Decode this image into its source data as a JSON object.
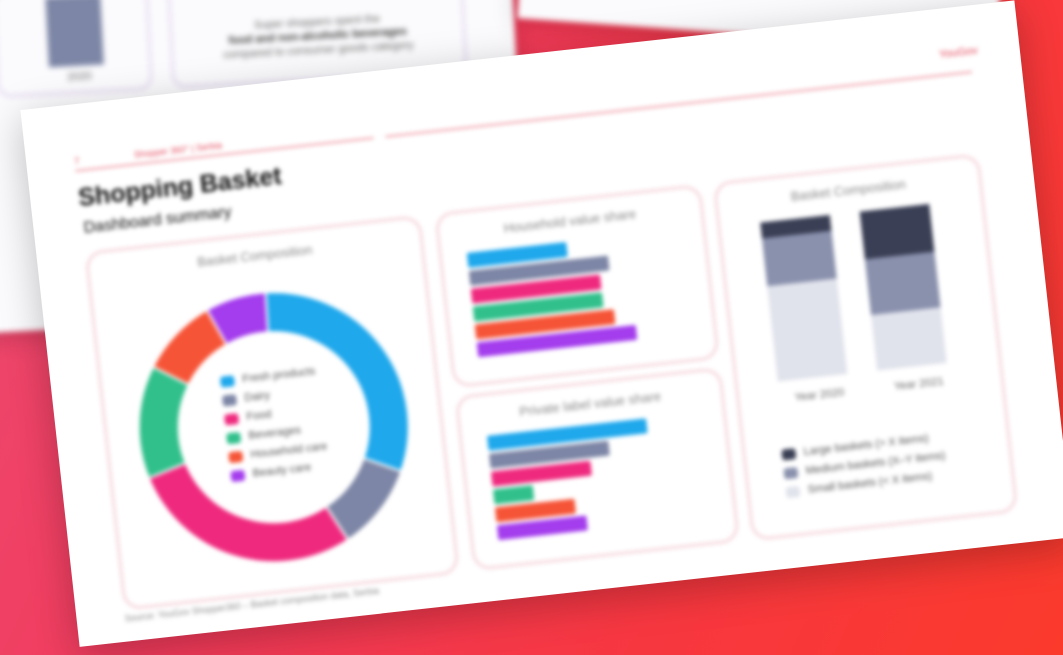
{
  "header": {
    "page_number": "7",
    "breadcrumb": "Shopper 360° | Serbia",
    "logo": "YouGov"
  },
  "title": "Shopping Basket",
  "subtitle": "Dashboard summary",
  "cards": {
    "donut_title": "Basket Composition",
    "brand_title": "Household value share",
    "pl_title": "Private label value share",
    "stack_title": "Basket Composition"
  },
  "colors": {
    "blue": "#1fa8ec",
    "slate": "#7d86a6",
    "pink": "#ef2a7e",
    "green": "#31c08c",
    "orange": "#f65437",
    "purple": "#a43ded",
    "dark": "#3a3f55",
    "mid": "#8a91ad",
    "light": "#c9cddc"
  },
  "donut_legend": [
    {
      "label": "Fresh products",
      "color": "#1fa8ec"
    },
    {
      "label": "Dairy",
      "color": "#7d86a6"
    },
    {
      "label": "Food",
      "color": "#ef2a7e"
    },
    {
      "label": "Beverages",
      "color": "#31c08c"
    },
    {
      "label": "Household care",
      "color": "#f65437"
    },
    {
      "label": "Beauty care",
      "color": "#a43ded"
    }
  ],
  "stack_legend": [
    {
      "label": "Large baskets (> X items)",
      "color": "#3a3f55"
    },
    {
      "label": "Medium baskets (X–Y items)",
      "color": "#8a91ad"
    },
    {
      "label": "Small baskets (< X items)",
      "color": "#e1e3ec"
    }
  ],
  "stack_axis": [
    "Year 2020",
    "Year 2021"
  ],
  "footer": "Source: YouGov Shopper360 – Basket composition data, Serbia",
  "background": {
    "left_text_1": "Super shoppers spent the",
    "left_text_2": "food and non-alcoholic beverages",
    "left_text_3": "compared to consumer goods category",
    "left_axis": "2020"
  },
  "chart_data": [
    {
      "type": "pie",
      "title": "Basket Composition",
      "categories": [
        "Fresh products",
        "Dairy",
        "Food",
        "Beverages",
        "Household care",
        "Beauty care"
      ],
      "values": [
        30,
        10,
        27,
        13,
        9,
        7
      ]
    },
    {
      "type": "bar",
      "title": "Household value share",
      "categories": [
        "Fresh products",
        "Dairy",
        "Food",
        "Beverages",
        "Household care",
        "Beauty care"
      ],
      "values": [
        50,
        70,
        65,
        65,
        70,
        80
      ]
    },
    {
      "type": "bar",
      "title": "Private label value share",
      "categories": [
        "Fresh products",
        "Dairy",
        "Food",
        "Beverages",
        "Household care",
        "Beauty care"
      ],
      "values": [
        80,
        60,
        50,
        20,
        40,
        45
      ]
    },
    {
      "type": "bar",
      "title": "Basket Composition",
      "categories": [
        "Year 2020",
        "Year 2021"
      ],
      "series": [
        {
          "name": "Large baskets (> X items)",
          "values": [
            10,
            30
          ]
        },
        {
          "name": "Medium baskets (X–Y items)",
          "values": [
            30,
            35
          ]
        },
        {
          "name": "Small baskets (< X items)",
          "values": [
            60,
            35
          ]
        }
      ],
      "ylim": [
        0,
        100
      ]
    }
  ]
}
